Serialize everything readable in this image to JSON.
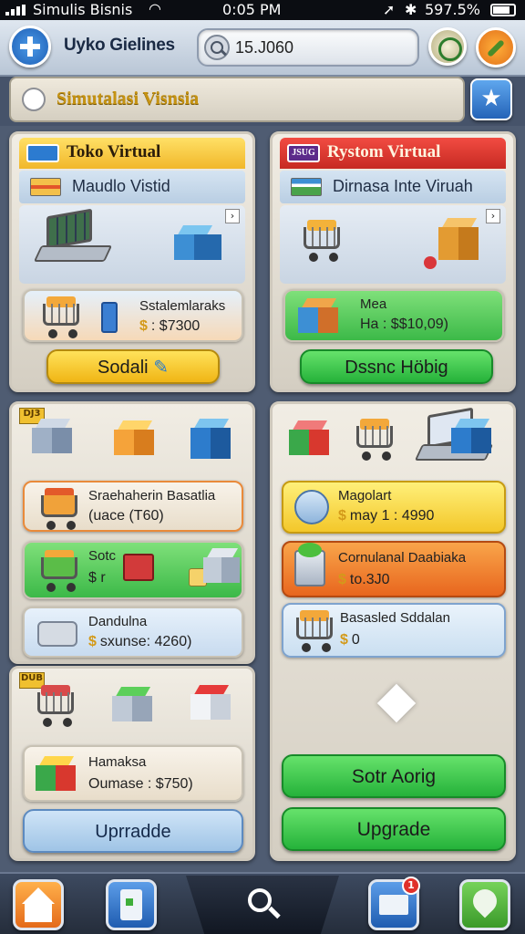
{
  "status": {
    "carrier": "Simulis Bisnis",
    "time": "0:05 PM",
    "battery": "597.5%"
  },
  "topbar": {
    "app_name": "Uyko Gielines",
    "search_value": "15.J060"
  },
  "banner": {
    "text": "Simutalasi Visnsia"
  },
  "panel_left_top": {
    "title": "Toko Virtual",
    "tag": "$$$",
    "sub": "Maudlo Vistid",
    "item_name": "Sstalemlaraks",
    "item_price": ": $7300",
    "button": "Sodali"
  },
  "panel_right_top": {
    "title": "Rystom Virtual",
    "tag": "JSUG",
    "sub": "Dirnasa Inte Viruah",
    "item_name": "Mea",
    "item_price": "Ha : $$10,09)",
    "button": "Dssnc Höbig"
  },
  "panel_left_mid": {
    "tag": "DJ3",
    "items": [
      {
        "name": "Sraehaherin Basatlia",
        "price": "(uace (T60)"
      },
      {
        "name": "Sotc",
        "price": "$ r"
      },
      {
        "name": "Dandulna",
        "price": "sxunse: 4260)"
      }
    ]
  },
  "panel_left_bottom": {
    "tag": "DUB",
    "item_name": "Hamaksa",
    "item_price": "Oumase : $750)",
    "button": "Uprradde"
  },
  "panel_right_mid": {
    "items": [
      {
        "name": "Magolart",
        "price": "may 1 : 4990"
      },
      {
        "name": "Cornulanal Daabiaka",
        "price": "to.3J0"
      },
      {
        "name": "Basasled Sddalan",
        "price": "0"
      }
    ],
    "button_primary": "Sotr Aorig",
    "button_upgrade": "Upgrade"
  },
  "colors": {
    "header_yellow": "#f5c842",
    "header_red": "#e0392f",
    "green": "#39c34b",
    "orange": "#f08a2a",
    "blue_item": "#d6e8f7"
  },
  "nav": {
    "items": [
      "home-icon",
      "wallet-icon",
      "search-icon",
      "mail-icon",
      "map-icon"
    ],
    "notification_badge": "1"
  }
}
